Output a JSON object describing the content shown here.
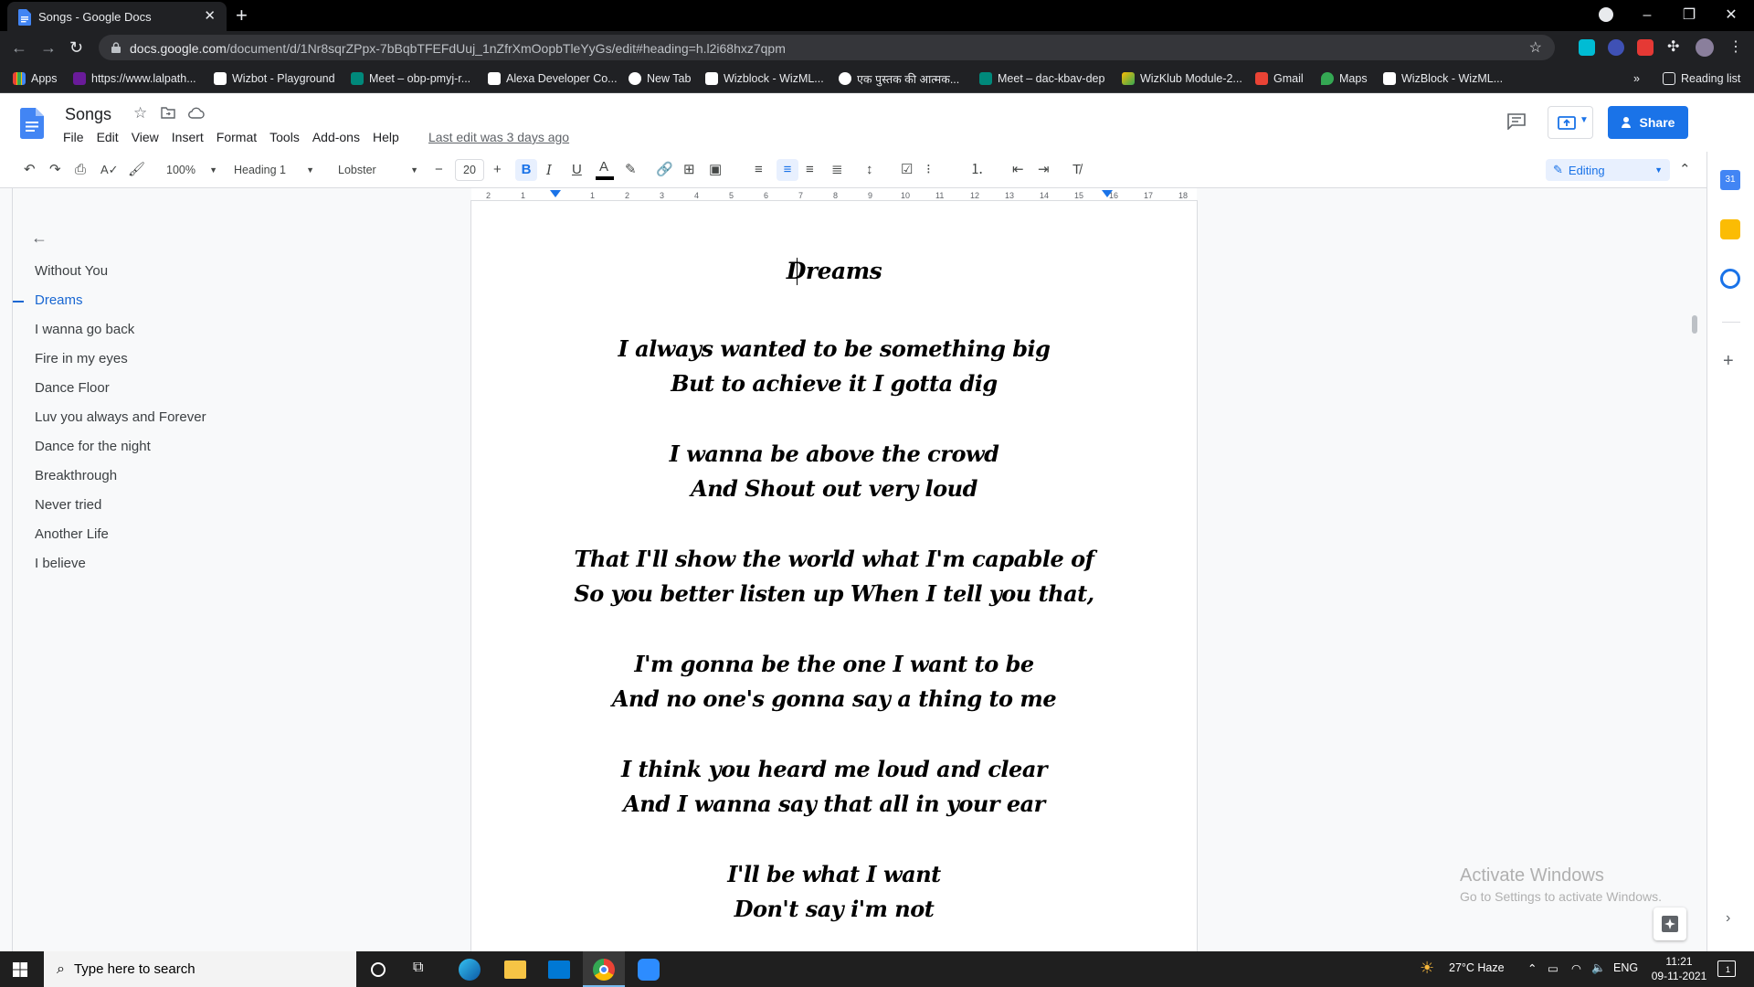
{
  "browser": {
    "tab_title": "Songs - Google Docs",
    "url_host": "docs.google.com",
    "url_path": "/document/d/1Nr8sqrZPpx-7bBqbTFEFdUuj_1nZfrXmOopbTleYyGs/edit#heading=h.l2i68hxz7qpm",
    "bookmarks": [
      "Apps",
      "https://www.lalpath...",
      "Wizbot - Playground",
      "Meet – obp-pmyj-r...",
      "Alexa Developer Co...",
      "New Tab",
      "Wizblock - WizML...",
      "एक पुस्तक की आत्मक...",
      "Meet – dac-kbav-dep",
      "WizKlub Module-2...",
      "Gmail",
      "Maps",
      "WizBlock - WizML..."
    ],
    "reading_list": "Reading list",
    "overflow": "»"
  },
  "docs": {
    "title": "Songs",
    "menu": [
      "File",
      "Edit",
      "View",
      "Insert",
      "Format",
      "Tools",
      "Add-ons",
      "Help"
    ],
    "last_edit": "Last edit was 3 days ago",
    "share_label": "Share"
  },
  "toolbar": {
    "zoom": "100%",
    "style": "Heading 1",
    "font": "Lobster",
    "font_size": "20",
    "mode": "Editing"
  },
  "ruler": {
    "ticks": [
      "2",
      "1",
      "1",
      "2",
      "3",
      "4",
      "5",
      "6",
      "7",
      "8",
      "9",
      "10",
      "11",
      "12",
      "13",
      "14",
      "15",
      "16",
      "17",
      "18"
    ]
  },
  "outline": {
    "items": [
      "Without You",
      "Dreams",
      "I wanna go back",
      "Fire in my eyes",
      "Dance Floor",
      "Luv you always and Forever",
      "Dance for the night",
      "Breakthrough",
      "Never tried",
      "Another Life",
      "I believe"
    ],
    "active_index": 1
  },
  "document": {
    "heading": "Dreams",
    "lines": [
      "I always wanted to be something big",
      "But to achieve it I gotta dig",
      "I wanna be above the crowd",
      "And Shout out very loud",
      "That I'll show the world what I'm capable of",
      "So you better listen up When I tell you that,",
      "I'm gonna be the one I want to be",
      "And no one's gonna say a thing to me",
      "I think you heard me loud and clear",
      "And I wanna say that all in your ear",
      "I'll be what I want",
      "Don't say i'm not"
    ]
  },
  "watermark": {
    "line1": "Activate Windows",
    "line2": "Go to Settings to activate Windows."
  },
  "taskbar": {
    "search_placeholder": "Type here to search",
    "weather": "27°C  Haze",
    "language": "ENG",
    "time": "11:21",
    "date": "09-11-2021",
    "notification_count": "1"
  },
  "colors": {
    "accent": "#1a73e8",
    "outline_active": "#1967d2",
    "chrome_dark": "#202124"
  }
}
